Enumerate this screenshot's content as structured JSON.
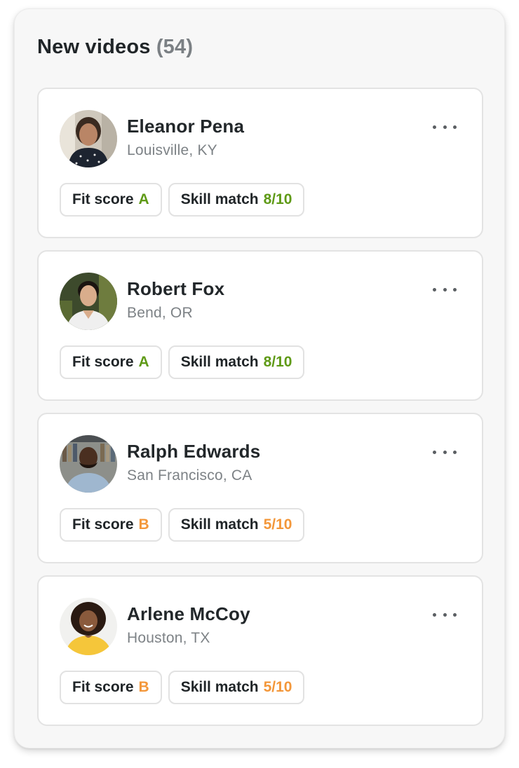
{
  "header": {
    "title": "New videos",
    "count": "(54)"
  },
  "candidates": [
    {
      "name": "Eleanor Pena",
      "location": "Louisville, KY",
      "fit_label": "Fit score",
      "fit_value": "A",
      "skill_label": "Skill match",
      "skill_value": "8/10",
      "rating_color": "#5f9a17"
    },
    {
      "name": "Robert Fox",
      "location": "Bend, OR",
      "fit_label": "Fit score",
      "fit_value": "A",
      "skill_label": "Skill match",
      "skill_value": "8/10",
      "rating_color": "#5f9a17"
    },
    {
      "name": "Ralph Edwards",
      "location": "San Francisco, CA",
      "fit_label": "Fit score",
      "fit_value": "B",
      "skill_label": "Skill match",
      "skill_value": "5/10",
      "rating_color": "#f3973a"
    },
    {
      "name": "Arlene McCoy",
      "location": "Houston, TX",
      "fit_label": "Fit score",
      "fit_value": "B",
      "skill_label": "Skill match",
      "skill_value": "5/10",
      "rating_color": "#f3973a"
    }
  ],
  "icons": {
    "more": "more-horizontal-icon",
    "avatar": "user-photo"
  },
  "colors": {
    "green": "#5f9a17",
    "orange": "#f3973a",
    "panel_bg": "#f7f7f7"
  }
}
